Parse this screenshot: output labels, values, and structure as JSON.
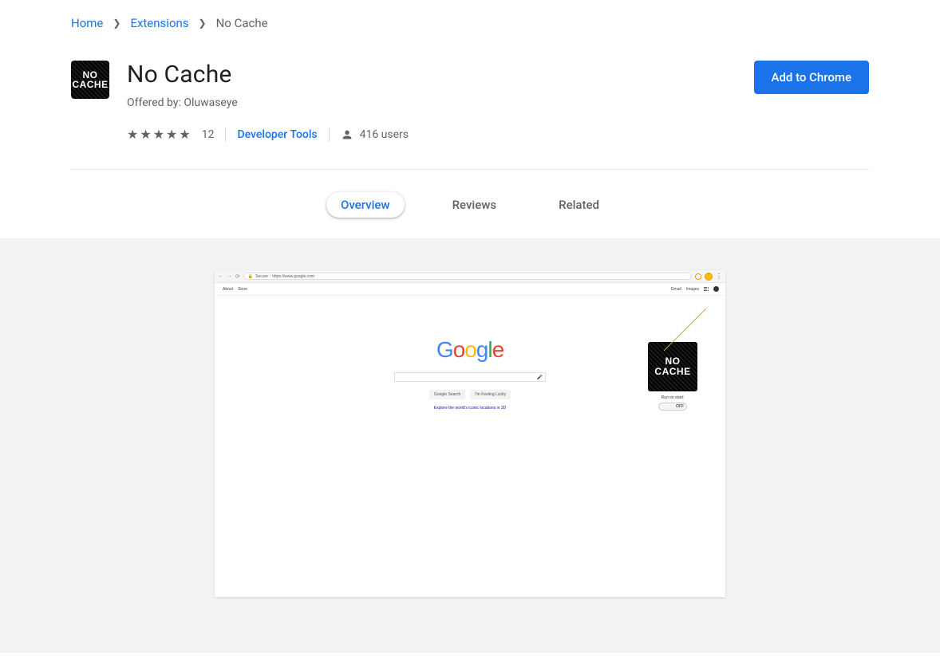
{
  "breadcrumb": {
    "home": "Home",
    "extensions": "Extensions",
    "current": "No Cache"
  },
  "header": {
    "title": "No Cache",
    "offered_by_prefix": "Offered by: ",
    "offered_by": "Oluwaseye",
    "rating_count": "12",
    "category": "Developer Tools",
    "users": "416 users",
    "icon_line1": "NO",
    "icon_line2": "CACHE",
    "add_button": "Add to Chrome"
  },
  "tabs": {
    "overview": "Overview",
    "reviews": "Reviews",
    "related": "Related"
  },
  "screenshot": {
    "url_secure": "Secure",
    "url": "https://www.google.com",
    "topbar": {
      "about": "About",
      "store": "Store",
      "gmail": "Gmail",
      "images": "Images"
    },
    "google_letters": [
      "G",
      "o",
      "o",
      "g",
      "l",
      "e"
    ],
    "buttons": {
      "search": "Google Search",
      "lucky": "I'm Feeling Lucky"
    },
    "explore": "Explore the world's iconic locations in 3D",
    "popup": {
      "line1": "NO",
      "line2": "CACHE",
      "label": "Run on start:",
      "toggle": "OFF"
    }
  }
}
